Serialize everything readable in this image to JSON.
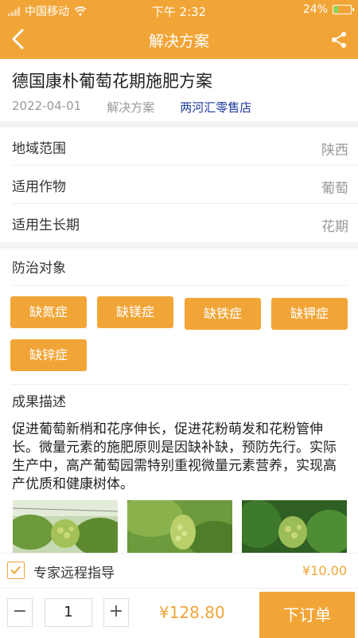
{
  "status_bar": {
    "carrier": "中国移动",
    "time": "下午 2:32",
    "battery_percent": "24%",
    "battery_level": 0.24
  },
  "nav": {
    "title": "解决方案"
  },
  "article": {
    "title": "德国康朴葡萄花期施肥方案",
    "date": "2022-04-01",
    "category": "解决方案",
    "store": "两河汇零售店"
  },
  "info": [
    {
      "key": "地域范围",
      "value": "陕西"
    },
    {
      "key": "适用作物",
      "value": "葡萄"
    },
    {
      "key": "适用生长期",
      "value": "花期"
    }
  ],
  "targets": {
    "title": "防治对象",
    "tags": [
      "缺氮症",
      "缺镁症",
      "缺铁症",
      "缺钾症",
      "缺锌症"
    ]
  },
  "results": {
    "title": "成果描述",
    "text": "促进葡萄新梢和花序伸长，促进花粉萌发和花粉管伸长。微量元素的施肥原则是因缺补缺，预防先行。实际生产中，高产葡萄园需特别重视微量元素营养，实现高产优质和健康树体。"
  },
  "expert": {
    "label": "专家远程指导",
    "price": "¥10.00",
    "checked": true
  },
  "order": {
    "quantity": "1",
    "minus": "−",
    "plus": "+",
    "total": "¥128.80",
    "button_label": "下订单"
  },
  "colors": {
    "accent": "#f2a537",
    "store_link": "#1f3a9e"
  }
}
